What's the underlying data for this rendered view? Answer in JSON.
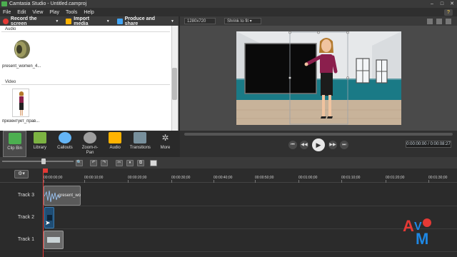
{
  "window": {
    "title": "Camtasia Studio - Untitled.camproj"
  },
  "menu": {
    "items": [
      "File",
      "Edit",
      "View",
      "Play",
      "Tools",
      "Help"
    ]
  },
  "toolbar": {
    "record": "Record the screen",
    "import": "Import media",
    "produce": "Produce and share"
  },
  "clipbin": {
    "sections": [
      {
        "label": "Audio",
        "item_caption": "present_women_4..."
      },
      {
        "label": "Video",
        "item_caption": "презентует_прав..."
      }
    ]
  },
  "tabs": [
    {
      "label": "Clip Bin",
      "icon": "film-icon"
    },
    {
      "label": "Library",
      "icon": "library-icon"
    },
    {
      "label": "Callouts",
      "icon": "callout-icon"
    },
    {
      "label": "Zoom-n-\nPan",
      "icon": "zoom-icon"
    },
    {
      "label": "Audio",
      "icon": "audio-icon"
    },
    {
      "label": "Transitions",
      "icon": "transitions-icon"
    },
    {
      "label": "More",
      "icon": "more-icon"
    }
  ],
  "preview": {
    "resolution": "1280x720",
    "zoom": "Shrink to fit"
  },
  "player": {
    "timecode": "0:00:00:00 / 0:00:08:27"
  },
  "ruler": {
    "labels": [
      "00:00:00;00",
      "00:00:10;00",
      "00:00:20;00",
      "00:00:30;00",
      "00:00:40;00",
      "00:00:50;00",
      "00:01:00;00",
      "00:01:10;00",
      "00:01:20;00",
      "00:01:30;00"
    ]
  },
  "tracks": [
    {
      "label": "Track 3",
      "clip": "present_wo"
    },
    {
      "label": "Track 2",
      "clip": ""
    },
    {
      "label": "Track 1",
      "clip": ""
    }
  ],
  "colors": {
    "record": "#e53935",
    "import": "#ffb300",
    "produce": "#42a5f5",
    "teal_wall": "#1a7a86"
  }
}
